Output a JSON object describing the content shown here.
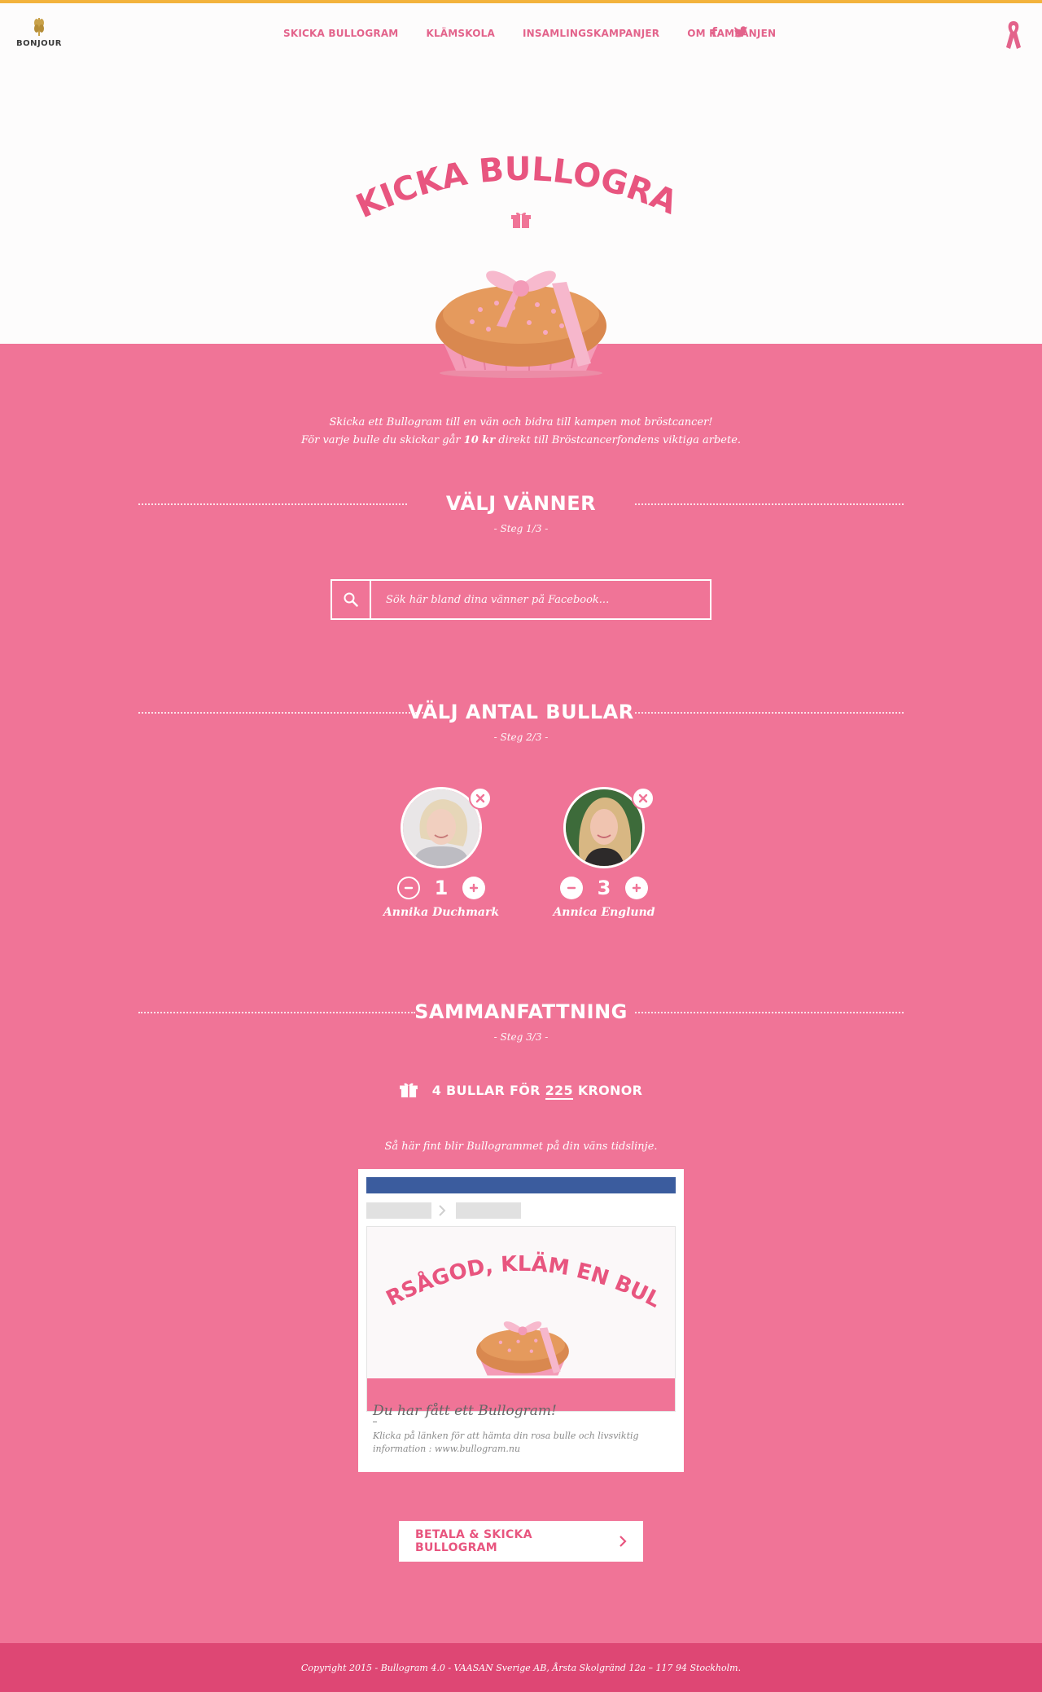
{
  "brand": {
    "logo_text": "BONJOUR",
    "trademark": "®"
  },
  "nav": {
    "items": [
      {
        "label": "SKICKA BULLOGRAM"
      },
      {
        "label": "KLÄMSKOLA"
      },
      {
        "label": "INSAMLINGSKAMPANJER"
      },
      {
        "label": "OM KAMPANJEN"
      }
    ],
    "social": [
      "facebook-icon",
      "twitter-icon"
    ]
  },
  "hero": {
    "title": "SKICKA BULLOGRAM"
  },
  "intro": {
    "line1": "Skicka ett Bullogram till en vän och bidra till kampen mot bröstcancer!",
    "line2_pre": "För varje bulle du skickar går ",
    "line2_bold": "10 kr",
    "line2_post": " direkt till Bröstcancerfondens viktiga arbete."
  },
  "steps": {
    "friends": {
      "title": "VÄLJ VÄNNER",
      "step": "- Steg 1/3 -"
    },
    "count": {
      "title": "VÄLJ ANTAL BULLAR",
      "step": "- Steg 2/3 -"
    },
    "summary": {
      "title": "SAMMANFATTNING",
      "step": "- Steg 3/3 -"
    }
  },
  "search": {
    "placeholder": "Sök här bland dina vänner på Facebook..."
  },
  "friends": [
    {
      "name": "Annika Duchmark",
      "count": "1"
    },
    {
      "name": "Annica Englund",
      "count": "3"
    }
  ],
  "summary": {
    "pre": "4 BULLAR FÖR",
    "amount": "225",
    "post": "KRONOR",
    "caption": "Så här fint blir Bullogrammet på din väns tidslinje."
  },
  "preview": {
    "card_title": "VARSÅGOD, KLÄM EN BULLE",
    "post_title": "Du har fått ett Bullogram!",
    "post_desc": "Klicka på länken för att hämta din rosa bulle och livsviktig information : www.bullogram.nu"
  },
  "cta": {
    "label": "BETALA & SKICKA BULLOGRAM"
  },
  "footer": {
    "text": "Copyright 2015 - Bullogram 4.0 - VAASAN Sverige AB, Årsta Skolgränd 12a – 117 94 Stockholm."
  },
  "colors": {
    "pink": "#f07497",
    "pink_dark": "#de4774",
    "accent_text": "#e3638b",
    "top_border": "#f3b33d",
    "facebook_blue": "#3b5c9e"
  }
}
